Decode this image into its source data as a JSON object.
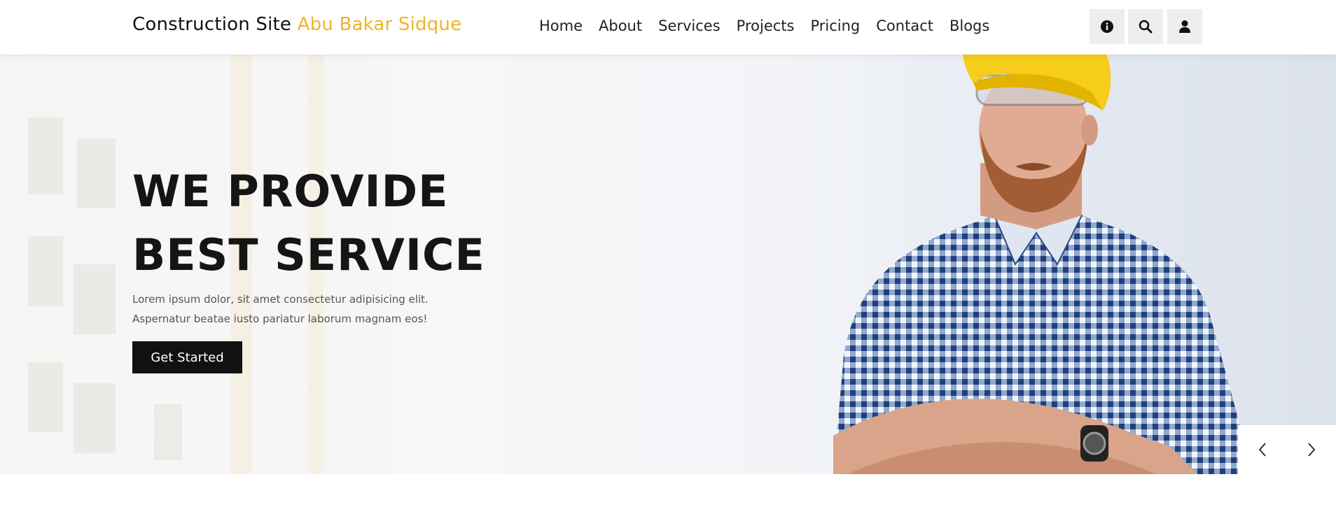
{
  "header": {
    "site_name": "Construction Site",
    "brand_name": "Abu Bakar Sidque",
    "nav": [
      {
        "label": "Home"
      },
      {
        "label": "About"
      },
      {
        "label": "Services"
      },
      {
        "label": "Projects"
      },
      {
        "label": "Pricing"
      },
      {
        "label": "Contact"
      },
      {
        "label": "Blogs"
      }
    ],
    "icons": [
      "info-icon",
      "search-icon",
      "user-icon"
    ]
  },
  "hero": {
    "title_line1": "WE PROVIDE",
    "title_line2": "BEST SERVICE",
    "text": "Lorem ipsum dolor, sit amet consectetur adipisicing elit. Aspernatur beatae iusto pariatur laborum magnam eos!",
    "cta_label": "Get Started"
  },
  "slider": {
    "prev_icon": "chevron-left-icon",
    "next_icon": "chevron-right-icon"
  },
  "colors": {
    "brand_accent": "#f0b429",
    "button_bg": "#111111",
    "icon_button_bg": "#eeeeee"
  }
}
